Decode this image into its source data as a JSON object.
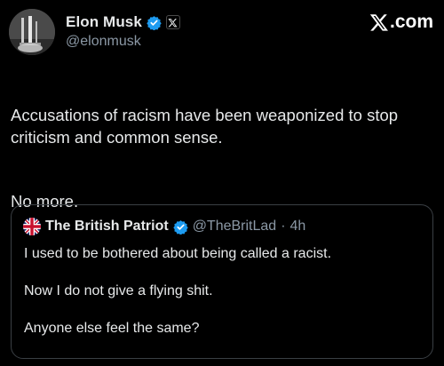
{
  "author": {
    "display_name": "Elon Musk",
    "handle": "@elonmusk",
    "verified_color": "#1d9bf0",
    "avatar_icon": "rocket-launch-avatar"
  },
  "site_brand": {
    "logo_icon": "x-logo-icon",
    "text": ".com"
  },
  "tweet": {
    "paragraph_1": "Accusations of racism have been weaponized to stop criticism and common sense.",
    "paragraph_2": "No more."
  },
  "quoted_tweet": {
    "display_name": "The British Patriot",
    "handle": "@TheBritLad",
    "separator": "·",
    "time": "4h",
    "verified_color": "#1d9bf0",
    "avatar_icon": "union-jack-avatar",
    "line_1": "I used to be bothered about being called a racist.",
    "line_2": "Now I do not give a flying shit.",
    "line_3": "Anyone else feel the same?"
  }
}
